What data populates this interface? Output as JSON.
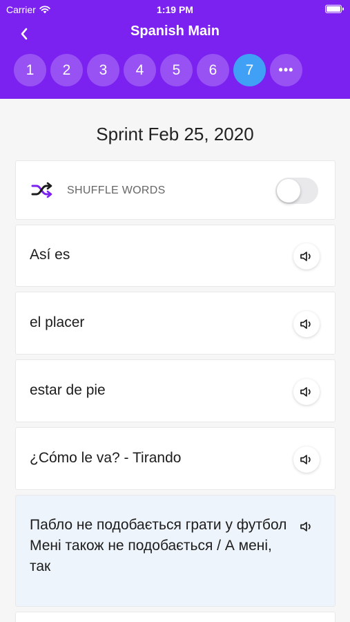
{
  "status_bar": {
    "carrier": "Carrier",
    "time": "1:19 PM"
  },
  "nav": {
    "title": "Spanish Main"
  },
  "pages": [
    "1",
    "2",
    "3",
    "4",
    "5",
    "6",
    "7"
  ],
  "active_page": "7",
  "more_label": "•••",
  "sprint": {
    "title": "Sprint Feb 25, 2020"
  },
  "shuffle": {
    "label": "SHUFFLE WORDS",
    "enabled": false
  },
  "words": [
    "Así es",
    "el placer",
    "estar de pie",
    "¿Cómo le va? - Tirando",
    "Пабло не подобається грати у футбол"
  ],
  "word5_line2": "Мені також не подобається / А мені, так",
  "colors": {
    "header": "#7b22f0",
    "active_page": "#3fa0f5",
    "highlight_card": "#eef4fb"
  }
}
